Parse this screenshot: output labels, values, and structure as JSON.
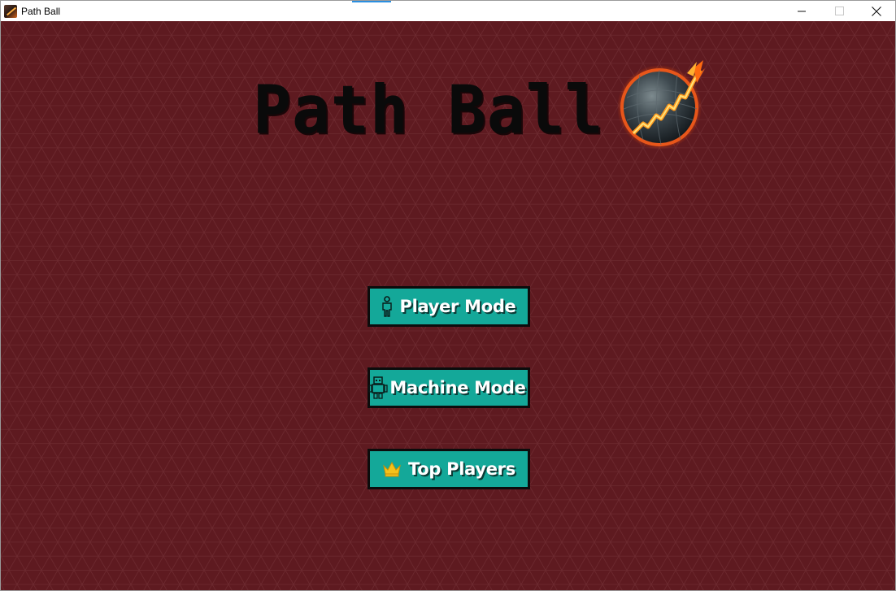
{
  "window": {
    "title": "Path Ball",
    "minimize_glyph": "—",
    "maximize_glyph": "☐",
    "close_glyph": "✕"
  },
  "game": {
    "title": "Path Ball",
    "logo_icon": "flaming-ball-icon"
  },
  "menu": {
    "buttons": [
      {
        "label": "Player Mode",
        "icon": "person-icon"
      },
      {
        "label": "Machine Mode",
        "icon": "robot-icon"
      },
      {
        "label": "Top Players",
        "icon": "crown-icon"
      }
    ]
  },
  "colors": {
    "background": "#5e1a20",
    "button": "#14a899",
    "button_border": "#0c0c0c",
    "crown": "#f4c21a"
  }
}
